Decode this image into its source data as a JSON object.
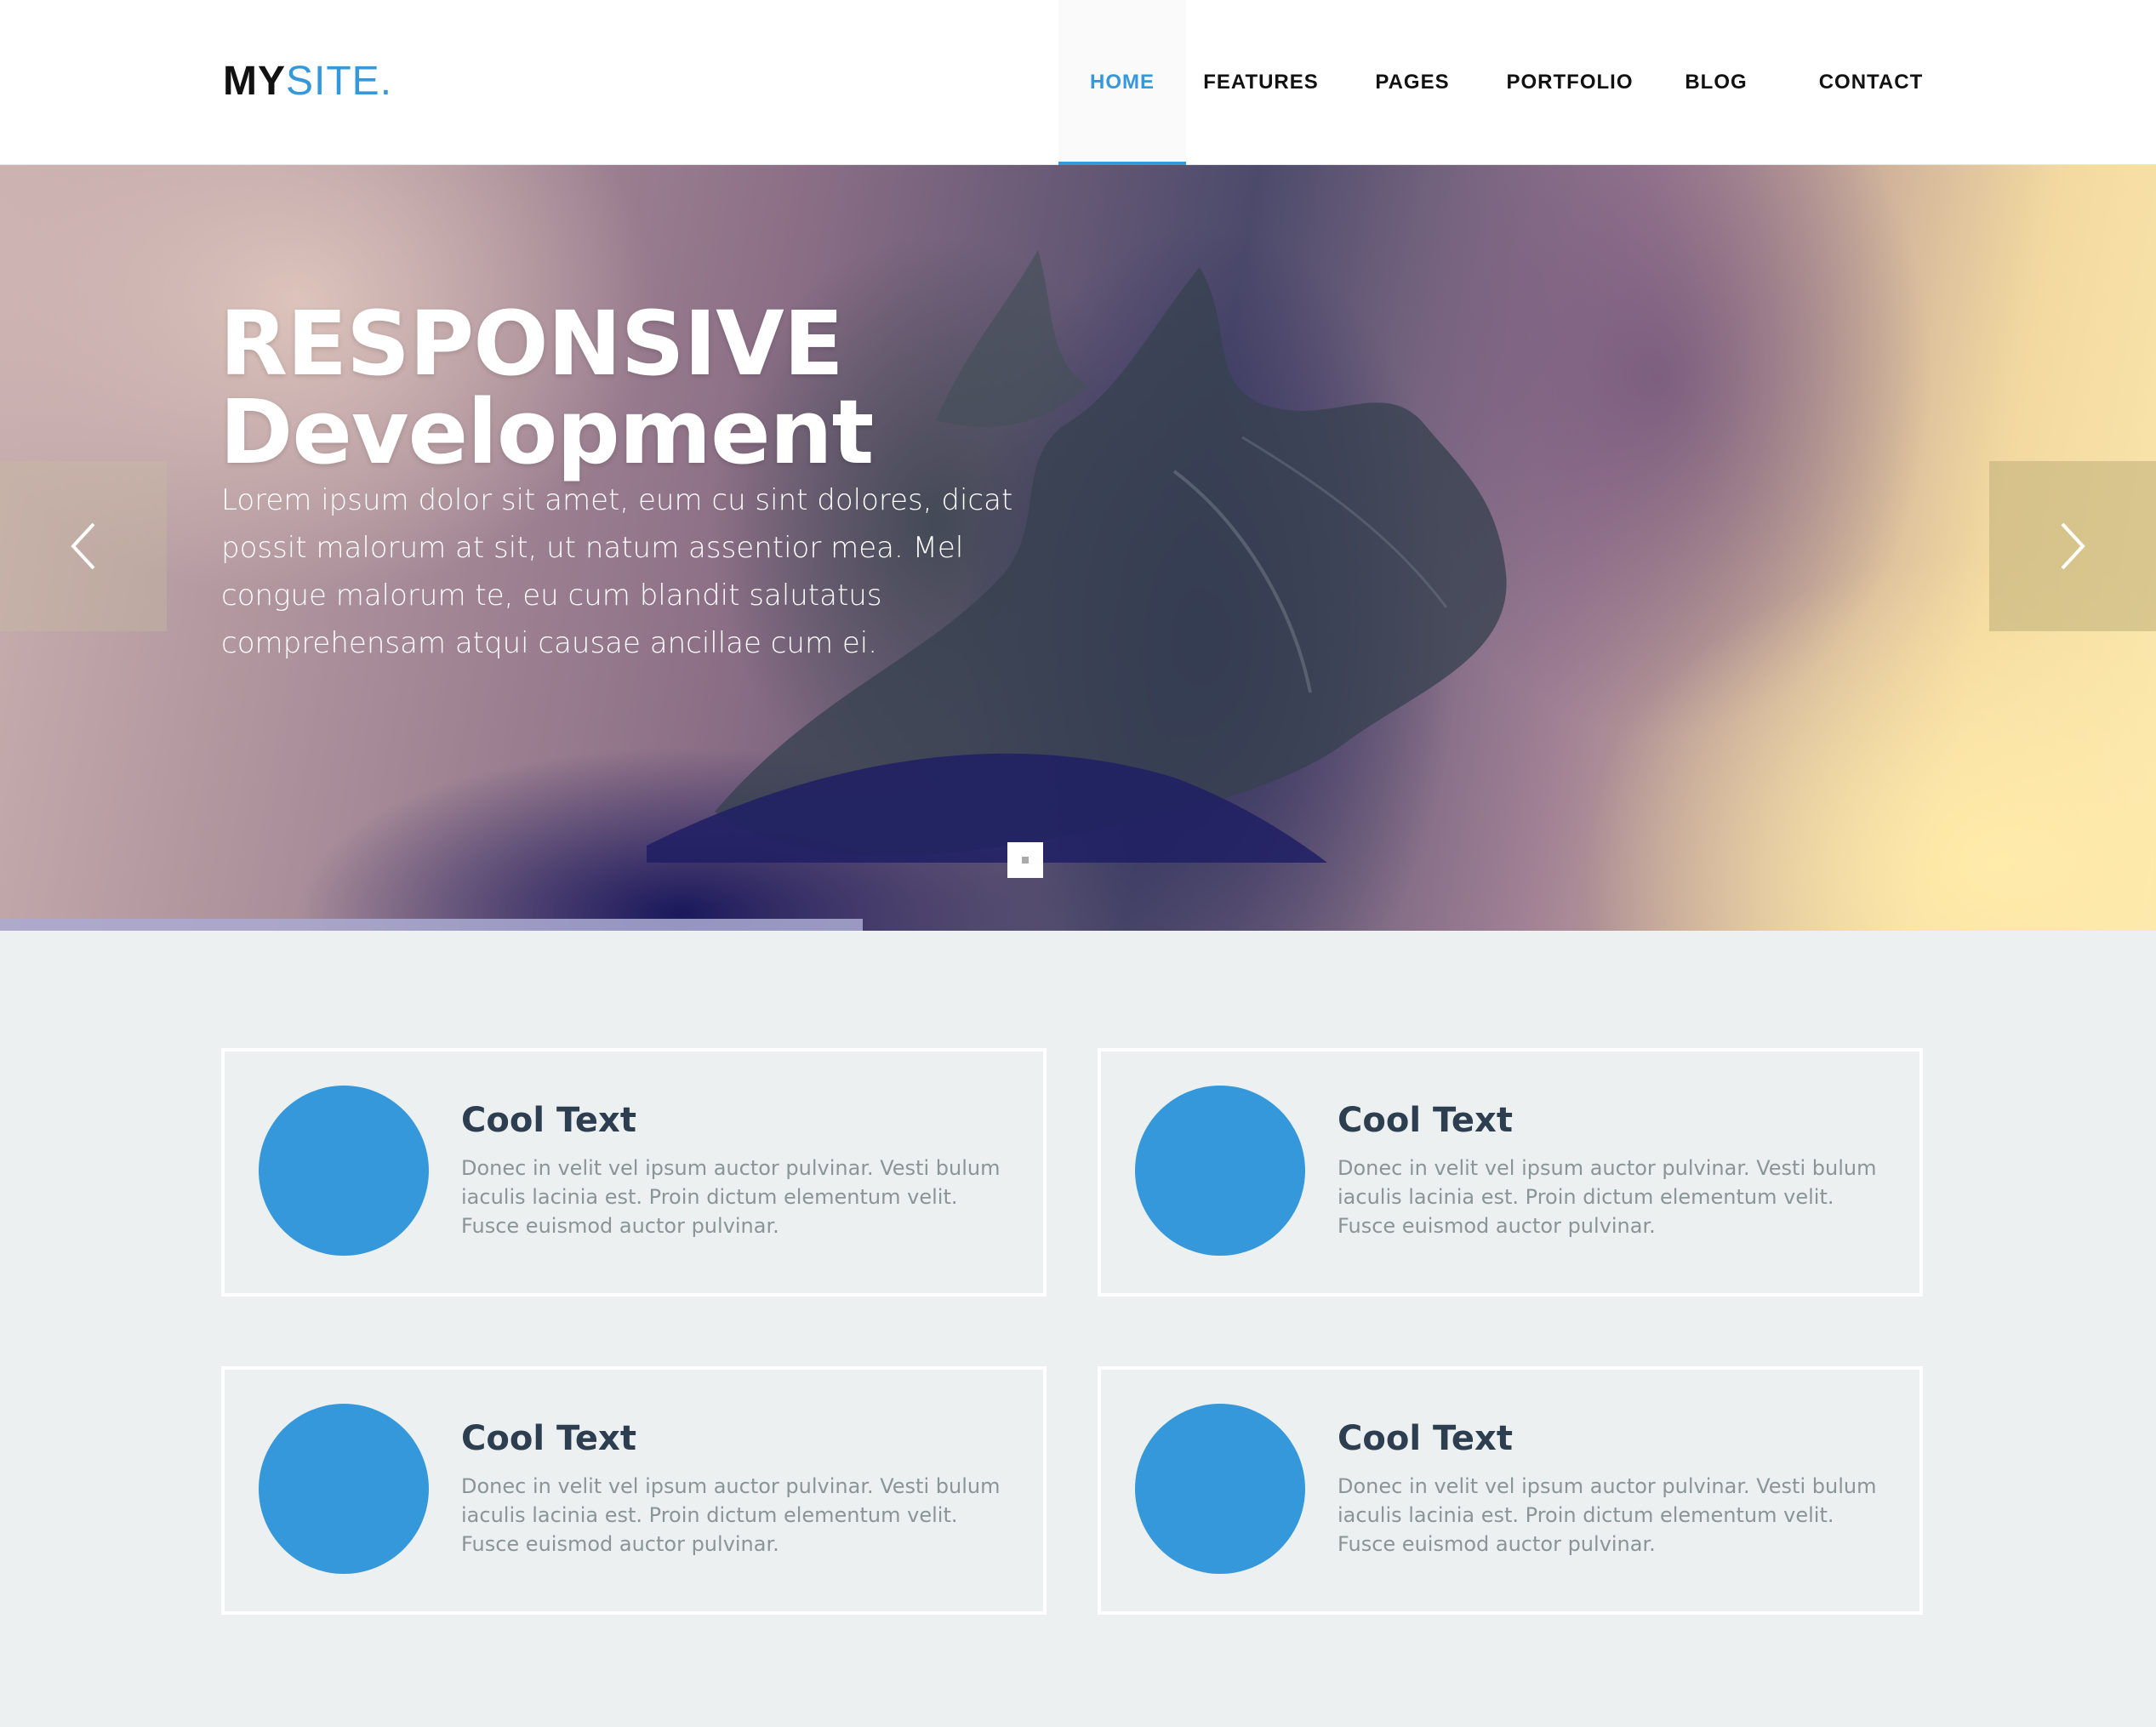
{
  "site": {
    "logo_bold": "MY",
    "logo_light": "SITE."
  },
  "nav": {
    "items": [
      {
        "label": "HOME",
        "active": true
      },
      {
        "label": "FEATURES",
        "active": false
      },
      {
        "label": "PAGES",
        "active": false
      },
      {
        "label": "PORTFOLIO",
        "active": false
      },
      {
        "label": "BLOG",
        "active": false
      },
      {
        "label": "CONTACT",
        "active": false
      }
    ]
  },
  "hero": {
    "title_line1": "RESPONSIVE",
    "title_line2": "Development",
    "text": "Lorem ipsum dolor sit amet, eum cu sint dolores, dicat possit malorum at sit, ut natum assentior mea. Mel congue malorum te, eu cum blandit salutatus comprehensam atqui causae ancillae cum ei.",
    "prev_icon": "chevron-left-icon",
    "next_icon": "chevron-right-icon",
    "slide_progress": 0.4
  },
  "features": [
    {
      "title": "Cool Text",
      "text": "Donec in velit vel ipsum auctor pulvinar. Vesti bulum iaculis lacinia est. Proin dictum elementum velit. Fusce euismod auctor pulvinar."
    },
    {
      "title": "Cool Text",
      "text": "Donec in velit vel ipsum auctor pulvinar. Vesti bulum iaculis lacinia est. Proin dictum elementum velit. Fusce euismod auctor pulvinar."
    },
    {
      "title": "Cool Text",
      "text": "Donec in velit vel ipsum auctor pulvinar. Vesti bulum iaculis lacinia est. Proin dictum elementum velit. Fusce euismod auctor pulvinar."
    },
    {
      "title": "Cool Text",
      "text": "Donec in velit vel ipsum auctor pulvinar. Vesti bulum iaculis lacinia est. Proin dictum elementum velit. Fusce euismod auctor pulvinar."
    }
  ],
  "colors": {
    "accent": "#3498db",
    "heading": "#2c3e50",
    "body_text": "#8a9596",
    "background": "#ecf0f1"
  }
}
